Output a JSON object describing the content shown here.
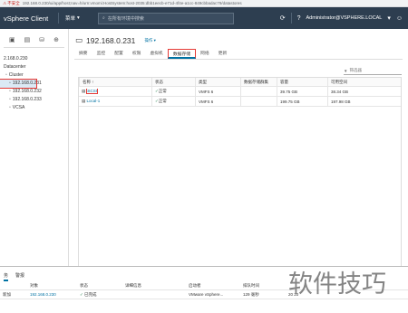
{
  "browser": {
    "warning": "⚠ 不安全",
    "url": "192.168.0.230/ui/app/host;nav=h/urn:vmomi:HostSystem:host-2035:dbb1eecb-e71d-4f4e-a1cc-849cbbadac79/datastores"
  },
  "header": {
    "title": "vSphere Client",
    "menu_label": "菜单",
    "search_placeholder": "在所有环境中搜索",
    "user": "Administrator@VSPHERE.LOCAL"
  },
  "nav": {
    "tree": [
      {
        "label": "2.168.0.230",
        "indent": 0
      },
      {
        "label": "Datacenter",
        "indent": 0
      },
      {
        "label": "Cluster",
        "indent": 4
      },
      {
        "label": "192.168.0.231",
        "indent": 8,
        "selected": true
      },
      {
        "label": "192.168.0.232",
        "indent": 8
      },
      {
        "label": "192.168.0.233",
        "indent": 8
      },
      {
        "label": "VCSA",
        "indent": 8
      }
    ]
  },
  "main": {
    "host_title": "192.168.0.231",
    "actions_label": "操作 ▾",
    "tabs": [
      "摘要",
      "监控",
      "配置",
      "权限",
      "虚拟机",
      "数据存储",
      "网络",
      "更新"
    ],
    "active_tab": 5,
    "filter_label": "筛选器",
    "columns": [
      "名称 ↑",
      "状态",
      "类型",
      "数据存储群集",
      "容量",
      "可用空间"
    ],
    "rows": [
      {
        "name": "iSCSI",
        "status": "正常",
        "type": "VMFS 6",
        "cluster": "",
        "capacity": "39.75 GB",
        "free": "38.34 GB"
      },
      {
        "name": "Local-1",
        "status": "正常",
        "type": "VMFS 6",
        "cluster": "",
        "capacity": "199.75 GB",
        "free": "197.98 GB"
      }
    ]
  },
  "bottom": {
    "tabs": [
      "务",
      "警报"
    ],
    "columns": [
      "",
      "对象",
      "状态",
      "详细信息",
      "启动者",
      "排队时间",
      ""
    ],
    "row": {
      "task": "新加",
      "object": "192.168.0.230",
      "status": "已完成",
      "details": "",
      "initiator": "VMware vSphere...",
      "queued": "129 毫秒",
      "start": "20\n20"
    }
  },
  "watermark": "软件技巧",
  "colors": {
    "header_bg": "#2d3e50",
    "accent": "#0072a3",
    "highlight": "#e53935",
    "ok": "#2e8b57"
  }
}
